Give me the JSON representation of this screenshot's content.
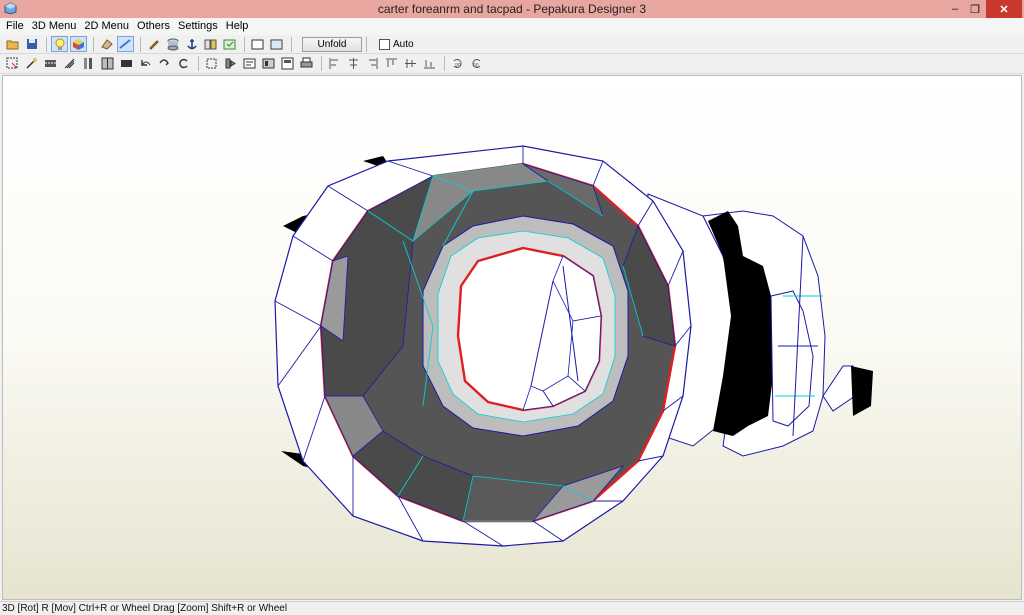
{
  "window": {
    "title": "carter foreanrm and tacpad - Pepakura Designer 3",
    "icon": "pepakura-app-icon",
    "controls": {
      "minimize": "–",
      "maximize": "❐",
      "close": "✕"
    }
  },
  "menu": {
    "items": [
      "File",
      "3D Menu",
      "2D Menu",
      "Others",
      "Settings",
      "Help"
    ]
  },
  "toolbar1": {
    "icons": [
      "open-icon",
      "save-icon",
      "lightbulb-icon",
      "texture-cube-icon",
      "rotate-part-icon",
      "select-icon",
      "edit-pencil-icon",
      "cylinder-icon",
      "anchor-icon",
      "split-icon",
      "join-icon",
      "single-view-icon",
      "split-view-icon"
    ],
    "unfold_label": "Unfold",
    "auto_label": "Auto",
    "auto_checked": false
  },
  "toolbar2": {
    "icons": [
      "select-tool-icon",
      "magic-wand-icon",
      "fold-line-icon",
      "flap-icon",
      "cut-icon",
      "edge-join-icon",
      "rectangle-icon",
      "undo-icon",
      "redo-icon",
      "refresh-icon",
      "bounding-icon",
      "flip-icon",
      "pt-icon",
      "layout-icon",
      "text-box-icon",
      "print-icon",
      "align-left-icon",
      "align-center-icon",
      "align-right-icon",
      "align-top-icon",
      "align-middle-icon",
      "align-bottom-icon",
      "rotate-90-ccw-icon",
      "rotate-90-cw-icon"
    ]
  },
  "viewport": {
    "label": "3D view"
  },
  "colors": {
    "titlebar": "#e7a7a0",
    "close": "#c7392c",
    "fold_line": "#1a1aa8",
    "seam_cyan": "#00d2d2",
    "cut_red": "#e02020",
    "dark_face": "#555555"
  },
  "status": {
    "text": "3D [Rot] R [Mov] Ctrl+R or Wheel Drag [Zoom] Shift+R or Wheel"
  }
}
